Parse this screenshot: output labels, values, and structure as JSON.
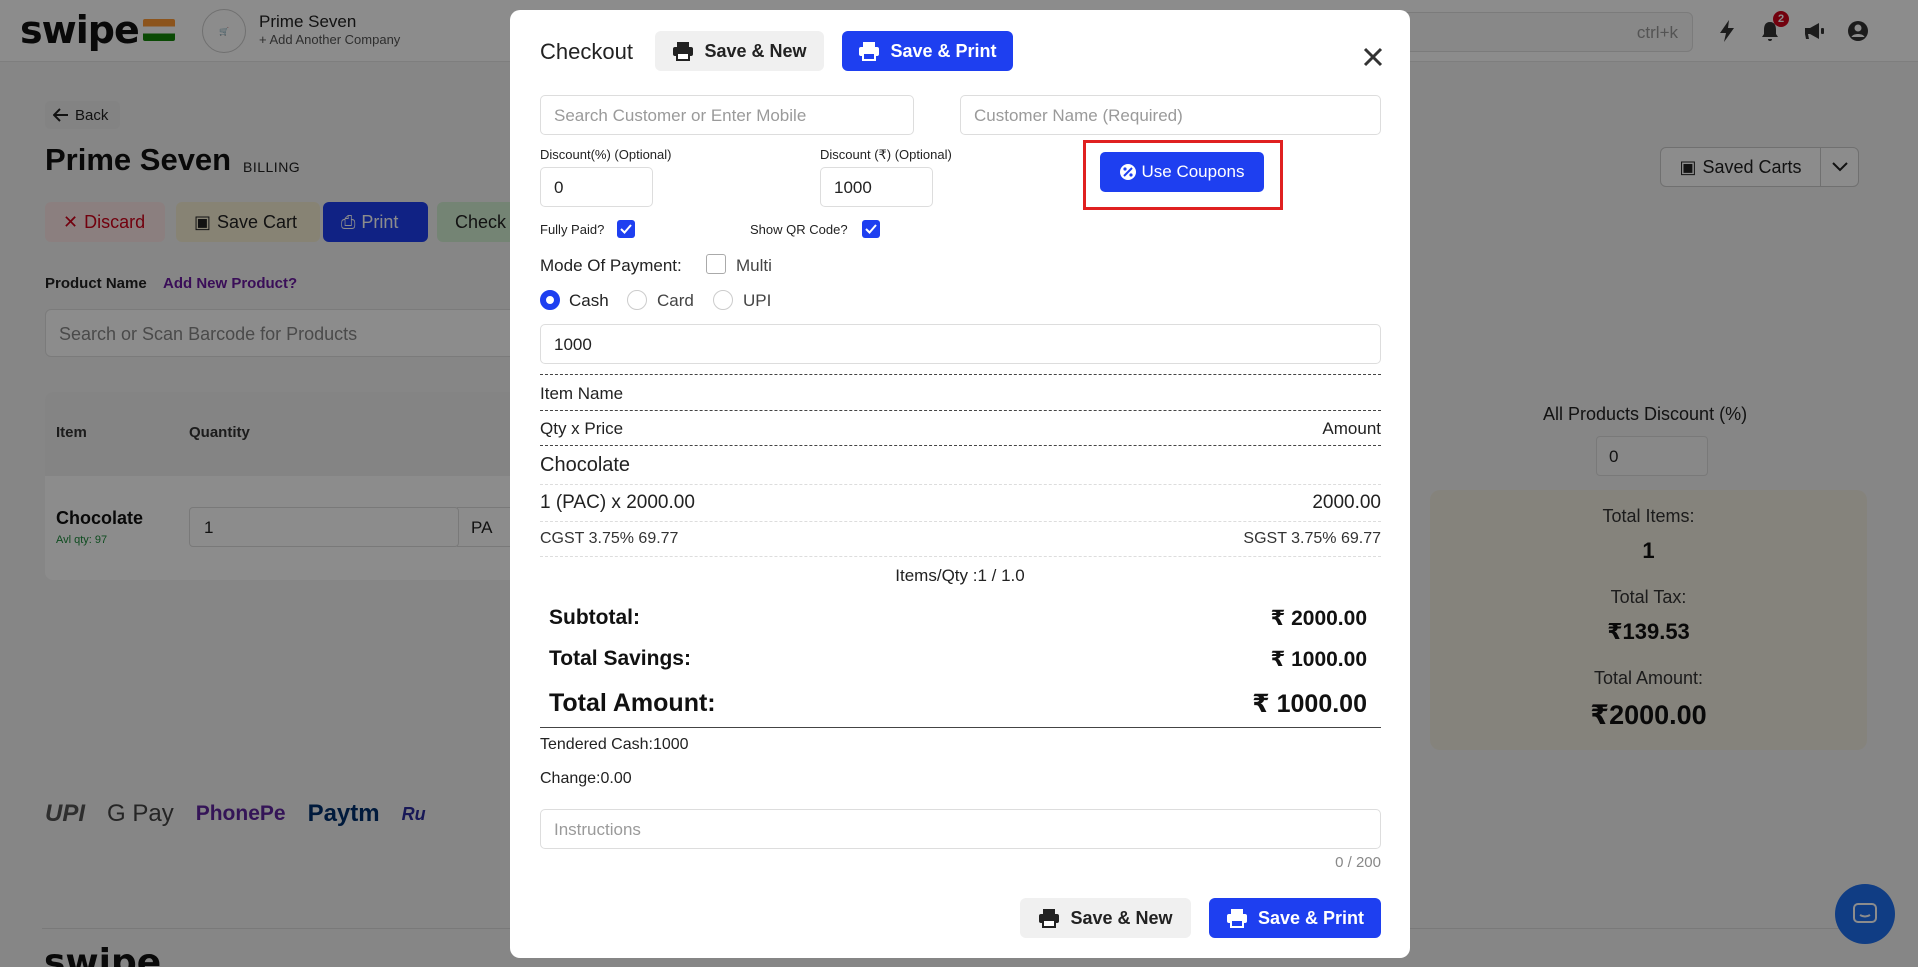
{
  "app": {
    "logo_text": "swipe",
    "company_name": "Prime Seven",
    "add_company": "+ Add Another Company",
    "shortcut": "ctrl+k",
    "notification_count": "2"
  },
  "page": {
    "back_label": "Back",
    "title": "Prime Seven",
    "subtitle": "BILLING",
    "discard_label": "Discard",
    "save_cart_label": "Save Cart",
    "print_label": "Print",
    "checkout_label": "Check",
    "product_label": "Product Name",
    "add_product_label": "Add New Product?",
    "product_search_placeholder": "Search or Scan Barcode for Products",
    "table_headers": {
      "item": "Item",
      "quantity": "Quantity"
    },
    "item": {
      "name": "Chocolate",
      "avl": "Avl qty: 97",
      "qty": "1",
      "unit": "PA"
    },
    "pay_logos": [
      "UPI",
      "G Pay",
      "PhonePe",
      "Paytm",
      "Ru"
    ],
    "saved_carts_label": "Saved Carts",
    "all_discount_label": "All Products Discount (%)",
    "all_discount_value": "0",
    "totals": {
      "items_label": "Total Items:",
      "items_value": "1",
      "tax_label": "Total Tax:",
      "tax_value": "₹139.53",
      "amount_label": "Total Amount:",
      "amount_value": "₹2000.00"
    },
    "footer_logo": "swipe"
  },
  "modal": {
    "title": "Checkout",
    "save_new_label": "Save & New",
    "save_print_label": "Save & Print",
    "customer_search_placeholder": "Search Customer or Enter Mobile",
    "customer_name_placeholder": "Customer Name (Required)",
    "discount_pct_label": "Discount(%) (Optional)",
    "discount_pct_value": "0",
    "discount_amt_label": "Discount (₹) (Optional)",
    "discount_amt_value": "1000",
    "coupons_label": "Use Coupons",
    "fully_paid_label": "Fully Paid?",
    "fully_paid_checked": true,
    "show_qr_label": "Show QR Code?",
    "show_qr_checked": true,
    "mode_label": "Mode Of Payment:",
    "multi_label": "Multi",
    "payment_options": [
      "Cash",
      "Card",
      "UPI"
    ],
    "payment_selected": "Cash",
    "amount_value": "1000",
    "col_item_name": "Item Name",
    "col_qty_price": "Qty x Price",
    "col_amount": "Amount",
    "line_item": {
      "name": "Chocolate",
      "qty_price": "1 (PAC) x 2000.00",
      "amount": "2000.00",
      "cgst": "CGST 3.75% 69.77",
      "sgst": "SGST 3.75% 69.77"
    },
    "items_qty": "Items/Qty :1 / 1.0",
    "subtotal_label": "Subtotal:",
    "subtotal_value": "₹ 2000.00",
    "savings_label": "Total Savings:",
    "savings_value": "₹ 1000.00",
    "total_label": "Total Amount:",
    "total_value": "₹ 1000.00",
    "tendered": "Tendered Cash:1000",
    "change": "Change:0.00",
    "instructions_placeholder": "Instructions",
    "char_count": "0 / 200"
  },
  "colors": {
    "primary": "#1e3ff0",
    "highlight": "#e02020",
    "danger": "#d0021b",
    "totals_bg": "#f3eee2"
  }
}
